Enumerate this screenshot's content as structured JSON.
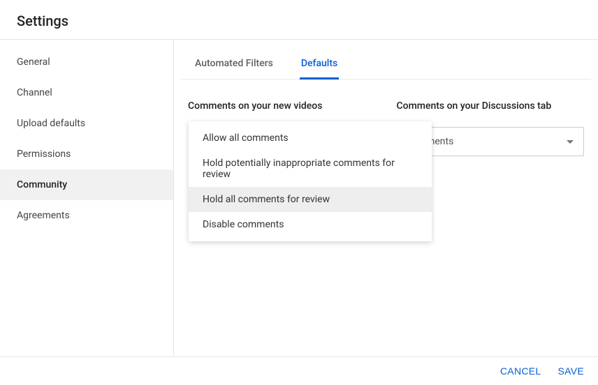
{
  "header": {
    "title": "Settings"
  },
  "sidebar": {
    "items": [
      {
        "label": "General",
        "active": false
      },
      {
        "label": "Channel",
        "active": false
      },
      {
        "label": "Upload defaults",
        "active": false
      },
      {
        "label": "Permissions",
        "active": false
      },
      {
        "label": "Community",
        "active": true
      },
      {
        "label": "Agreements",
        "active": false
      }
    ]
  },
  "tabs": [
    {
      "label": "Automated Filters",
      "active": false
    },
    {
      "label": "Defaults",
      "active": true
    }
  ],
  "section": {
    "left_label": "Comments on your new videos",
    "right_label": "Comments on your Discussions tab",
    "right_select_value": "comments"
  },
  "dropdown": {
    "options": [
      {
        "label": "Allow all comments",
        "highlight": false
      },
      {
        "label": "Hold potentially inappropriate comments for review",
        "highlight": false
      },
      {
        "label": "Hold all comments for review",
        "highlight": true
      },
      {
        "label": "Disable comments",
        "highlight": false
      }
    ]
  },
  "footer": {
    "cancel": "CANCEL",
    "save": "SAVE"
  }
}
